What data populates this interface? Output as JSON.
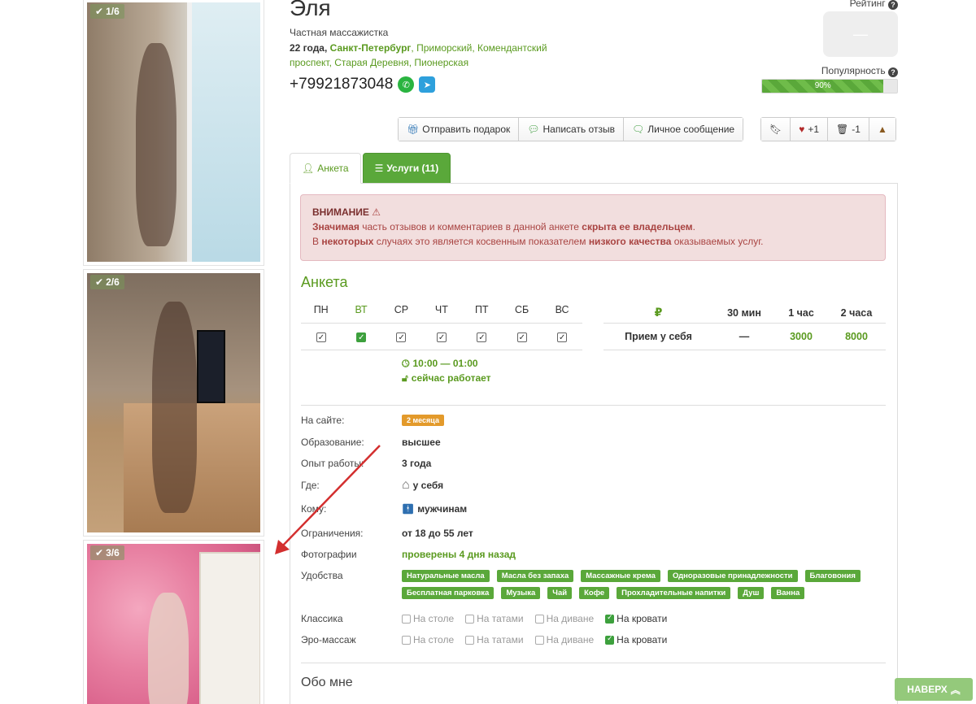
{
  "photos": [
    {
      "badge": "1/6"
    },
    {
      "badge": "2/6"
    },
    {
      "badge": "3/6"
    }
  ],
  "profile": {
    "name": "Эля",
    "type": "Частная массажистка",
    "age": "22 года,",
    "city": "Санкт-Петербург",
    "location_rest": ", Приморский, Комендантский проспект, Старая Деревня, Пионерская",
    "phone": "+79921873048"
  },
  "rating": {
    "label": "Рейтинг",
    "value": "—"
  },
  "popularity": {
    "label": "Популярность",
    "value": 0.9,
    "text": "90%"
  },
  "actions": {
    "gift": "Отправить подарок",
    "review": "Написать отзыв",
    "message": "Личное сообщение"
  },
  "votes": {
    "up": "+1",
    "down": "-1"
  },
  "tabs": {
    "anketa": "Анкета",
    "services": "Услуги (11)"
  },
  "alert": {
    "title": "ВНИМАНИЕ",
    "line1_a": "Значимая",
    "line1_b": " часть отзывов и комментариев в данной анкете ",
    "line1_c": "скрыта ее владельцем",
    "line1_d": ".",
    "line2_a": "В ",
    "line2_b": "некоторых",
    "line2_c": " случаях это является косвенным показателем ",
    "line2_d": "низкого качества",
    "line2_e": " оказываемых услуг."
  },
  "section_title": "Анкета",
  "schedule": {
    "days": [
      "ПН",
      "ВТ",
      "СР",
      "ЧТ",
      "ПТ",
      "СБ",
      "ВС"
    ],
    "today_index": 1,
    "hours": "10:00 — 01:00",
    "status": "сейчас работает"
  },
  "prices": {
    "currency": "₽",
    "headers": [
      "30 мин",
      "1 час",
      "2 часа"
    ],
    "row_label": "Прием у себя",
    "values": [
      "—",
      "3000",
      "8000"
    ]
  },
  "info": {
    "on_site_label": "На сайте:",
    "on_site_value": "2 месяца",
    "education_label": "Образование:",
    "education_value": "высшее",
    "experience_label": "Опыт работы:",
    "experience_value": "3 года",
    "where_label": "Где:",
    "where_value": "у себя",
    "whom_label": "Кому:",
    "whom_value": "мужчинам",
    "limits_label": "Ограничения:",
    "limits_value": "от 18 до 55 лет",
    "photos_label": "Фотографии",
    "photos_value": "проверены 4 дня назад",
    "amenities_label": "Удобства",
    "classic_label": "Классика",
    "ero_label": "Эро-массаж"
  },
  "amenities": [
    "Натуральные масла",
    "Масла без запаха",
    "Массажные крема",
    "Одноразовые принадлежности",
    "Благовония",
    "Бесплатная парковка",
    "Музыка",
    "Чай",
    "Кофе",
    "Прохладительные напитки",
    "Душ",
    "Ванна"
  ],
  "massage_places": [
    "На столе",
    "На татами",
    "На диване",
    "На кровати"
  ],
  "about_title": "Обо мне",
  "top_button": "НАВЕРХ",
  "colors": {
    "brand_green": "#5aa83a",
    "alert_bg": "#f2dede",
    "alert_text": "#a94442",
    "arrow": "#d32f2f"
  }
}
